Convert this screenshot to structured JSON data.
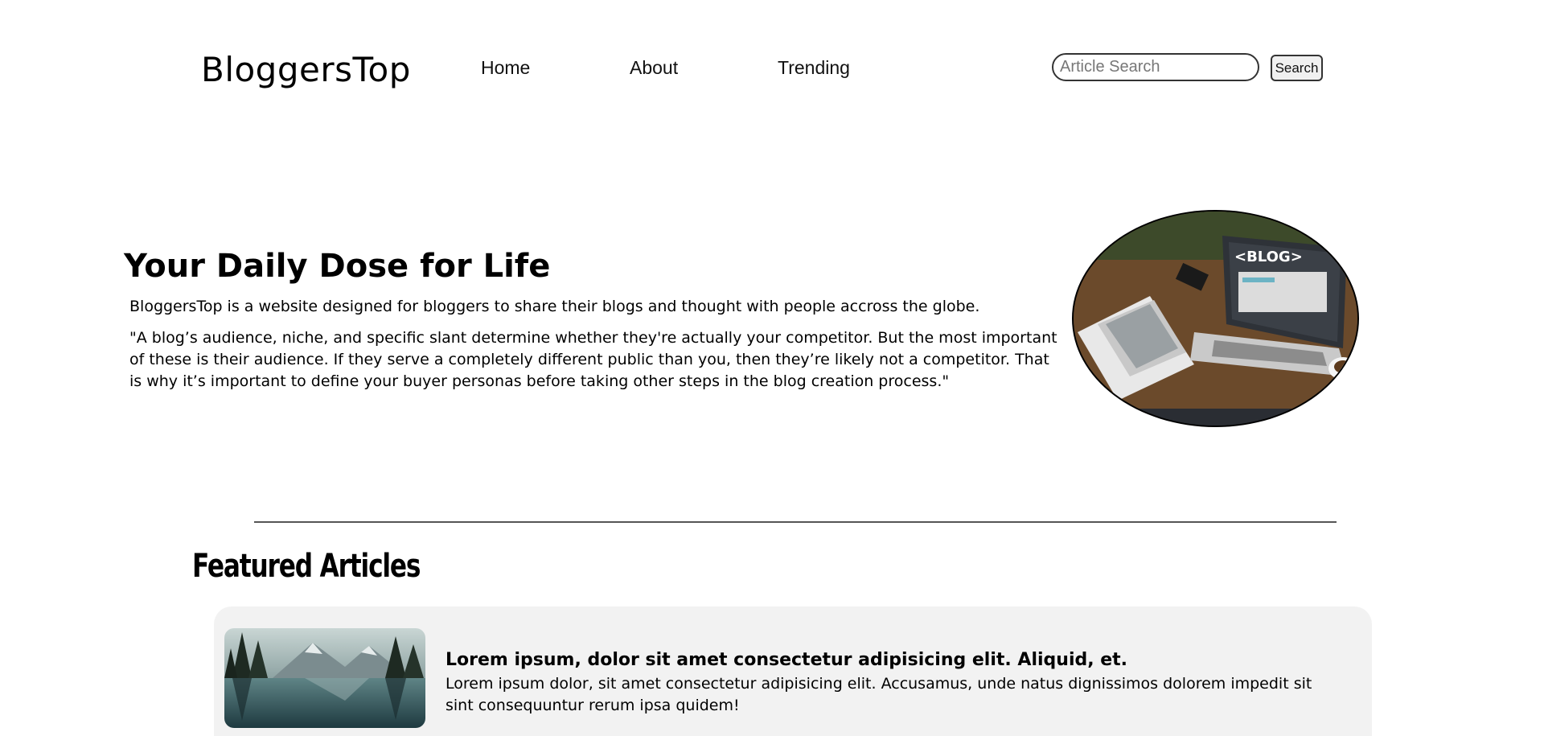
{
  "header": {
    "logo": "BloggersTop",
    "nav": {
      "home": "Home",
      "about": "About",
      "trending": "Trending"
    },
    "search": {
      "placeholder": "Article Search",
      "button_label": "Search"
    }
  },
  "hero": {
    "title": "Your Daily Dose for Life",
    "intro": "BloggersTop is a website designed for bloggers to share their blogs and thought with people accross the globe.",
    "quote": "\"A blog’s audience, niche, and specific slant determine whether they're actually your competitor. But the most important of these is their audience. If they serve a completely different public than you, then they’re likely not a competitor. That is why it’s important to define your buyer personas before taking other steps in the blog creation process.\"",
    "image_label": "<BLOG>"
  },
  "featured": {
    "heading": "Featured Articles",
    "articles": [
      {
        "title": "Lorem ipsum, dolor sit amet consectetur adipisicing elit. Aliquid, et.",
        "description": "Lorem ipsum dolor, sit amet consectetur adipisicing elit. Accusamus, unde natus dignissimos dolorem impedit sit sint consequuntur rerum ipsa quidem!"
      }
    ]
  }
}
